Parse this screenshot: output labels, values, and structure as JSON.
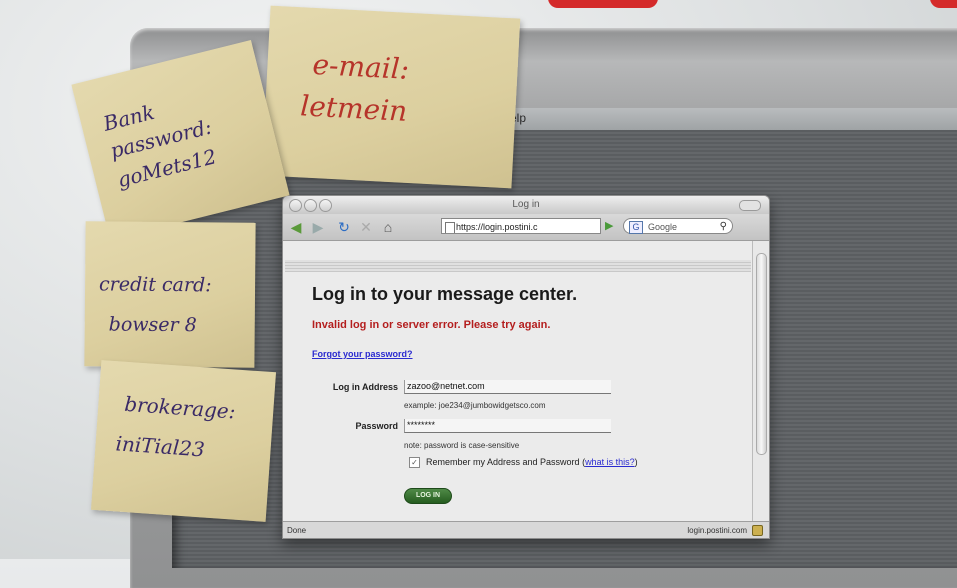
{
  "browser": {
    "window_title": "Log in",
    "url": "https://login.postini.c",
    "search_placeholder": "Google",
    "status_left": "Done",
    "status_right": "login.postini.com"
  },
  "menubar": {
    "partial_label": "elp"
  },
  "page": {
    "heading": "Log in to your message center.",
    "error": "Invalid log in or server error. Please try again.",
    "forgot_link": "Forgot your password?",
    "address_label": "Log in Address",
    "address_value": "zazoo@netnet.com",
    "address_hint": "example: joe234@jumbowidgetsco.com",
    "password_label": "Password",
    "password_value": "********",
    "password_hint": "note: password is case-sensitive",
    "remember_text": "Remember my Address and Password",
    "remember_link": "what is this?",
    "login_button": "LOG IN"
  },
  "notes": {
    "email": {
      "line1": "e-mail:",
      "line2": "letmein"
    },
    "bank": {
      "line1": "Bank",
      "line2": "password:",
      "line3": "goMets12"
    },
    "credit": {
      "line1": "credit card:",
      "line2": "bowser 8"
    },
    "brokerage": {
      "line1": "brokerage:",
      "line2": "iniTial23"
    }
  },
  "colors": {
    "error_red": "#b41e1e",
    "link_blue": "#2a2ad0",
    "note_yellow": "#dccf9f",
    "login_green": "#255c1f"
  }
}
